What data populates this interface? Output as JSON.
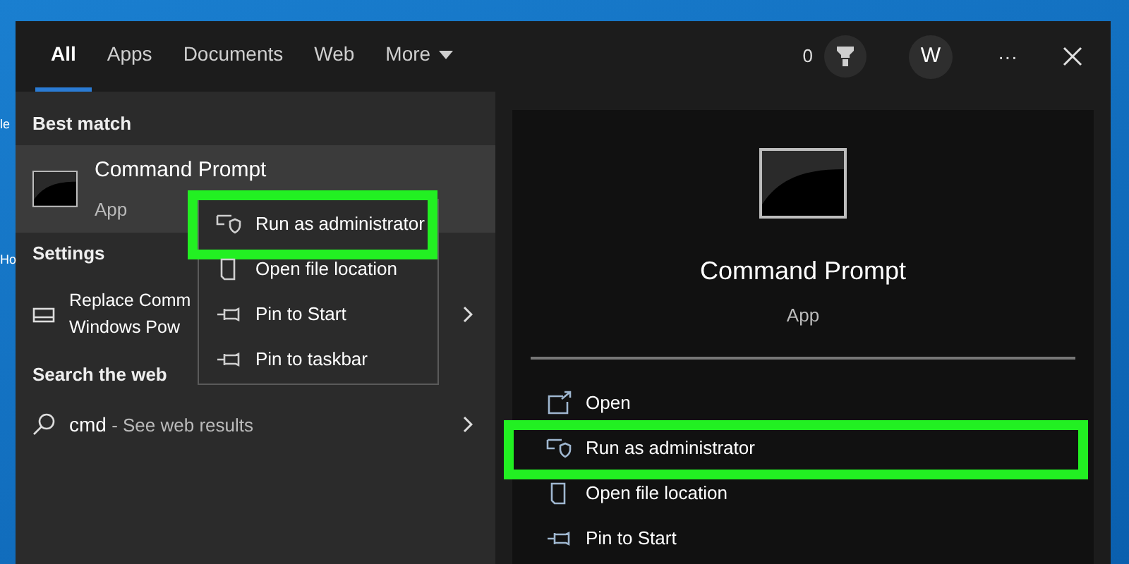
{
  "desktop_icons": [
    {
      "label": "le"
    },
    {
      "label": "Ho"
    }
  ],
  "tabs": [
    {
      "label": "All",
      "selected": true
    },
    {
      "label": "Apps",
      "selected": false
    },
    {
      "label": "Documents",
      "selected": false
    },
    {
      "label": "Web",
      "selected": false
    },
    {
      "label": "More",
      "selected": false,
      "kind": "dropdown"
    }
  ],
  "header": {
    "points": "0",
    "avatar": "W",
    "more": "···"
  },
  "results": [
    {
      "kind": "header",
      "label": "Best match"
    },
    {
      "kind": "app",
      "title": "Command Prompt",
      "subtitle": "App",
      "selected": true
    },
    {
      "kind": "header",
      "label": "Settings"
    },
    {
      "kind": "setting",
      "lines": [
        "Replace Comm",
        "Windows Pow"
      ],
      "selected": false
    },
    {
      "kind": "header",
      "label": "Search the web"
    },
    {
      "kind": "web",
      "query": "cmd",
      "suffix": " - See web results",
      "selected": false
    }
  ],
  "context_menu": [
    {
      "label": "Run as administrator",
      "kind": "shield",
      "highlighted": true
    },
    {
      "label": "Open file location",
      "kind": "folder",
      "highlighted": false
    },
    {
      "label": "Pin to Start",
      "kind": "pin",
      "highlighted": false
    },
    {
      "label": "Pin to taskbar",
      "kind": "pin",
      "highlighted": false
    }
  ],
  "preview": {
    "title": "Command Prompt",
    "subtitle": "App",
    "actions": [
      {
        "label": "Open",
        "kind": "open",
        "highlighted": false
      },
      {
        "label": "Run as administrator",
        "kind": "shield",
        "highlighted": true
      },
      {
        "label": "Open file location",
        "kind": "folder",
        "highlighted": false
      },
      {
        "label": "Pin to Start",
        "kind": "pin",
        "highlighted": false
      }
    ]
  }
}
